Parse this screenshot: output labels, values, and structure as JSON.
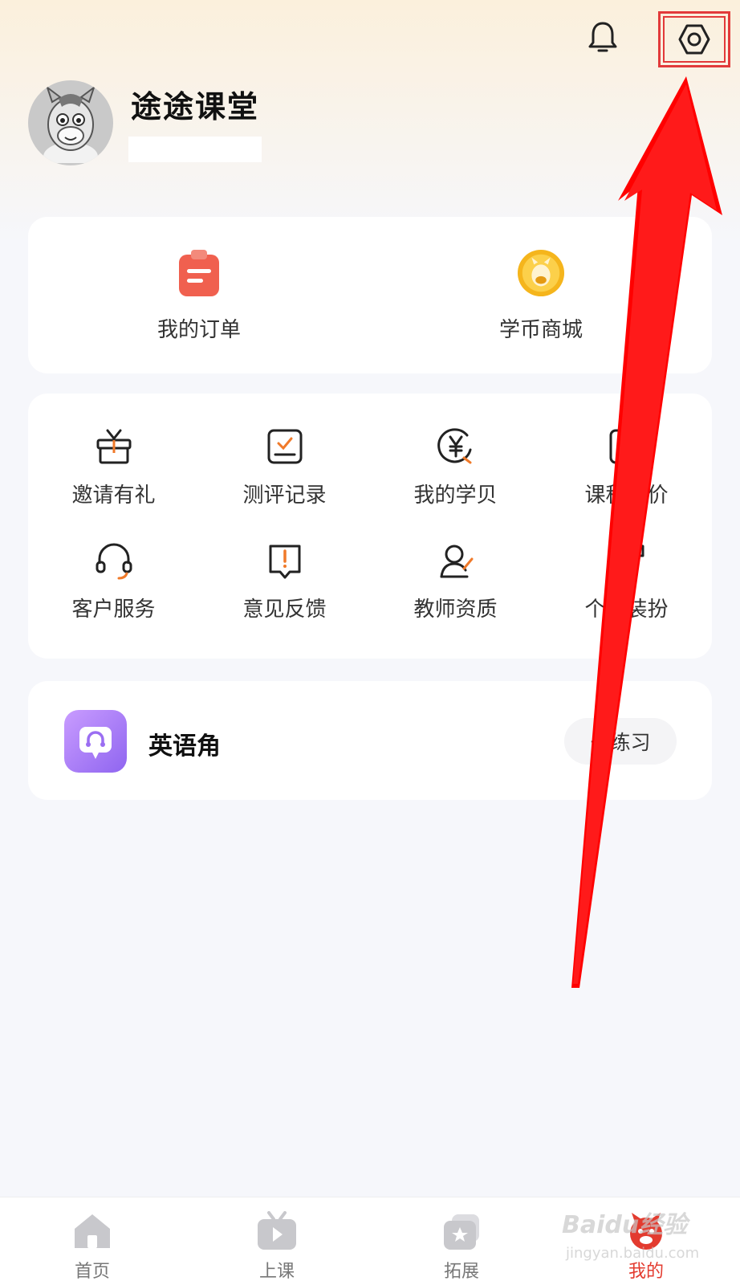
{
  "header": {
    "bell_icon": "bell-icon",
    "settings_icon": "settings-gear-icon",
    "highlight_color": "#e23a3a"
  },
  "profile": {
    "name": "途途课堂",
    "avatar_icon": "donkey-avatar"
  },
  "quick": [
    {
      "label": "我的订单",
      "icon": "order-clipboard-icon"
    },
    {
      "label": "学币商城",
      "icon": "coin-mall-icon"
    }
  ],
  "grid": [
    {
      "label": "邀请有礼",
      "icon": "gift-icon"
    },
    {
      "label": "测评记录",
      "icon": "assessment-icon"
    },
    {
      "label": "我的学贝",
      "icon": "yen-coin-icon"
    },
    {
      "label": "课程评价",
      "icon": "course-review-icon"
    },
    {
      "label": "客户服务",
      "icon": "headset-icon"
    },
    {
      "label": "意见反馈",
      "icon": "feedback-icon"
    },
    {
      "label": "教师资质",
      "icon": "teacher-icon"
    },
    {
      "label": "个性装扮",
      "icon": "shirt-icon"
    }
  ],
  "english_corner": {
    "title": "英语角",
    "action": "去练习",
    "icon_colors": [
      "#c99cff",
      "#8f65f0"
    ]
  },
  "tabs": [
    {
      "label": "首页",
      "icon": "home-icon",
      "active": false
    },
    {
      "label": "上课",
      "icon": "play-tv-icon",
      "active": false
    },
    {
      "label": "拓展",
      "icon": "star-box-icon",
      "active": false
    },
    {
      "label": "我的",
      "icon": "donkey-face-icon",
      "active": true
    }
  ],
  "watermark": {
    "text": "Baidu经验",
    "sub": "jingyan.baidu.com"
  },
  "colors": {
    "accent": "#e33b2f",
    "arrow": "#ff0000",
    "background": "#f6f7fb"
  }
}
